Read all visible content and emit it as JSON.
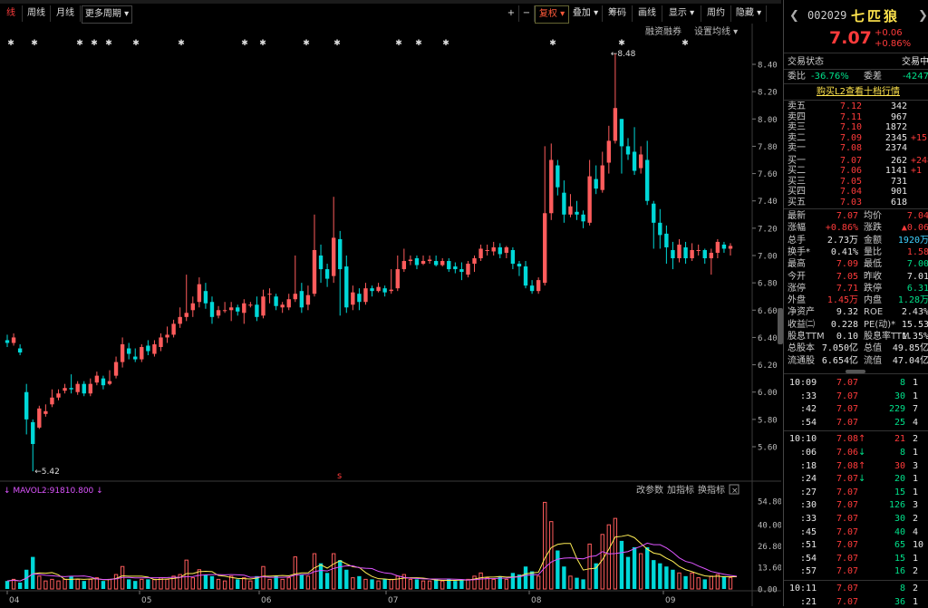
{
  "toolbar": {
    "buttons": [
      "线",
      "周线",
      "月线",
      "更多周期 ▾"
    ],
    "right_buttons": [
      "+",
      "−",
      "复权 ▾",
      "叠加 ▾",
      "筹码",
      "画线",
      "显示 ▾",
      "周约",
      "隐藏 ▾"
    ],
    "active": "线"
  },
  "chart": {
    "top_links": [
      "融资融券",
      "设置均线 ▾"
    ],
    "high_label": "8.48",
    "low_label": "5.42",
    "y_ticks": [
      "8.40",
      "8.20",
      "8.00",
      "7.80",
      "7.60",
      "7.40",
      "7.20",
      "7.00",
      "6.80",
      "6.60",
      "6.40",
      "6.20",
      "6.00",
      "5.80",
      "5.60"
    ],
    "s_marker": "s",
    "vol_indicator": "MAVOL2:91810.800",
    "vol_links": [
      "改参数",
      "加指标",
      "换指标"
    ],
    "vol_ticks": [
      "54.80",
      "40.00",
      "26.80",
      "13.60",
      "0.00"
    ],
    "months": [
      "04",
      "05",
      "06",
      "07",
      "08",
      "09"
    ]
  },
  "quote": {
    "code": "002029",
    "name": "七匹狼",
    "price": "7.07",
    "change": "+0.06",
    "change_pct": "+0.86%",
    "status_label": "交易状态",
    "status_value": "交易中",
    "wei_bi_label": "委比",
    "wei_bi": "-36.76%",
    "wei_cha_label": "委差",
    "wei_cha": "-4247",
    "buy_l2": "购买L2查看十档行情"
  },
  "asks": [
    {
      "label": "卖五",
      "price": "7.12",
      "vol": "342",
      "chg": ""
    },
    {
      "label": "卖四",
      "price": "7.11",
      "vol": "967",
      "chg": ""
    },
    {
      "label": "卖三",
      "price": "7.10",
      "vol": "1872",
      "chg": ""
    },
    {
      "label": "卖二",
      "price": "7.09",
      "vol": "2345",
      "chg": "+15"
    },
    {
      "label": "卖一",
      "price": "7.08",
      "vol": "2374",
      "chg": ""
    }
  ],
  "bids": [
    {
      "label": "买一",
      "price": "7.07",
      "vol": "262",
      "chg": "+248"
    },
    {
      "label": "买二",
      "price": "7.06",
      "vol": "1141",
      "chg": "+1"
    },
    {
      "label": "买三",
      "price": "7.05",
      "vol": "731",
      "chg": ""
    },
    {
      "label": "买四",
      "price": "7.04",
      "vol": "901",
      "chg": ""
    },
    {
      "label": "买五",
      "price": "7.03",
      "vol": "618",
      "chg": ""
    }
  ],
  "stats": [
    {
      "l1": "最新",
      "v1": "7.07",
      "c1": "red",
      "l2": "均价",
      "v2": "7.04",
      "c2": "red"
    },
    {
      "l1": "涨幅",
      "v1": "+0.86%",
      "c1": "red",
      "l2": "涨跌",
      "v2": "▲0.06",
      "c2": "red"
    },
    {
      "l1": "总手",
      "v1": "2.73万",
      "c1": "white",
      "l2": "金额",
      "v2": "1920万",
      "c2": "cyan"
    },
    {
      "l1": "换手*",
      "v1": "0.41%",
      "c1": "white",
      "l2": "量比",
      "v2": "1.58",
      "c2": "red"
    },
    {
      "l1": "最高",
      "v1": "7.09",
      "c1": "red",
      "l2": "最低",
      "v2": "7.00",
      "c2": "green"
    },
    {
      "l1": "今开",
      "v1": "7.05",
      "c1": "red",
      "l2": "昨收",
      "v2": "7.01",
      "c2": "white"
    },
    {
      "l1": "涨停",
      "v1": "7.71",
      "c1": "red",
      "l2": "跌停",
      "v2": "6.31",
      "c2": "green"
    },
    {
      "l1": "外盘",
      "v1": "1.45万",
      "c1": "red",
      "l2": "内盘",
      "v2": "1.28万",
      "c2": "green"
    },
    {
      "l1": "净资产",
      "v1": "9.32",
      "c1": "white",
      "l2": "ROE",
      "v2": "2.43%",
      "c2": "white"
    },
    {
      "l1": "收益㈡",
      "v1": "0.228",
      "c1": "white",
      "l2": "PE(动)*",
      "v2": "15.53",
      "c2": "white"
    },
    {
      "l1": "股息TTM",
      "v1": "0.10",
      "c1": "white",
      "l2": "股息率TTM",
      "v2": "1.35%",
      "c2": "white"
    },
    {
      "l1": "总股本",
      "v1": "7.050亿",
      "c1": "white",
      "l2": "总值",
      "v2": "49.85亿",
      "c2": "white"
    },
    {
      "l1": "流通股",
      "v1": "6.654亿",
      "c1": "white",
      "l2": "流值",
      "v2": "47.04亿",
      "c2": "white"
    }
  ],
  "ticks": [
    {
      "time": "10:09",
      "price": "7.07",
      "arrow": "",
      "vol": "8",
      "n": "1",
      "vc": "green"
    },
    {
      "time": ":33",
      "price": "7.07",
      "arrow": "",
      "vol": "30",
      "n": "1",
      "vc": "green"
    },
    {
      "time": ":42",
      "price": "7.07",
      "arrow": "",
      "vol": "229",
      "n": "7",
      "vc": "green"
    },
    {
      "time": ":54",
      "price": "7.07",
      "arrow": "",
      "vol": "25",
      "n": "4",
      "vc": "green"
    },
    {
      "time": "10:10",
      "price": "7.08",
      "arrow": "↑",
      "vol": "21",
      "n": "2",
      "vc": "red"
    },
    {
      "time": ":06",
      "price": "7.06",
      "arrow": "↓",
      "vol": "8",
      "n": "1",
      "vc": "green"
    },
    {
      "time": ":18",
      "price": "7.08",
      "arrow": "↑",
      "vol": "30",
      "n": "3",
      "vc": "red"
    },
    {
      "time": ":24",
      "price": "7.07",
      "arrow": "↓",
      "vol": "20",
      "n": "1",
      "vc": "green"
    },
    {
      "time": ":27",
      "price": "7.07",
      "arrow": "",
      "vol": "15",
      "n": "1",
      "vc": "green"
    },
    {
      "time": ":30",
      "price": "7.07",
      "arrow": "",
      "vol": "126",
      "n": "3",
      "vc": "green"
    },
    {
      "time": ":33",
      "price": "7.07",
      "arrow": "",
      "vol": "30",
      "n": "2",
      "vc": "green"
    },
    {
      "time": ":45",
      "price": "7.07",
      "arrow": "",
      "vol": "40",
      "n": "4",
      "vc": "green"
    },
    {
      "time": ":51",
      "price": "7.07",
      "arrow": "",
      "vol": "65",
      "n": "10",
      "vc": "green"
    },
    {
      "time": ":54",
      "price": "7.07",
      "arrow": "",
      "vol": "15",
      "n": "1",
      "vc": "green"
    },
    {
      "time": ":57",
      "price": "7.07",
      "arrow": "",
      "vol": "16",
      "n": "2",
      "vc": "green"
    },
    {
      "time": "10:11",
      "price": "7.07",
      "arrow": "",
      "vol": "8",
      "n": "2",
      "vc": "green"
    },
    {
      "time": ":21",
      "price": "7.07",
      "arrow": "",
      "vol": "36",
      "n": "1",
      "vc": "green"
    }
  ],
  "candles": [
    [
      6.38,
      6.36,
      6.42,
      6.33
    ],
    [
      6.36,
      6.4,
      6.43,
      6.34
    ],
    [
      6.32,
      6.29,
      6.35,
      6.27
    ],
    [
      6.0,
      5.8,
      6.06,
      5.69
    ],
    [
      5.78,
      5.62,
      5.8,
      5.42
    ],
    [
      5.74,
      5.88,
      5.9,
      5.73
    ],
    [
      5.84,
      5.86,
      5.91,
      5.82
    ],
    [
      5.91,
      5.96,
      6.02,
      5.89
    ],
    [
      5.96,
      5.99,
      6.02,
      5.94
    ],
    [
      6.01,
      6.03,
      6.06,
      5.99
    ],
    [
      6.03,
      6.02,
      6.13,
      5.99
    ],
    [
      6.0,
      6.06,
      6.08,
      5.98
    ],
    [
      6.06,
      5.99,
      6.08,
      5.97
    ],
    [
      5.99,
      6.06,
      6.1,
      5.97
    ],
    [
      6.07,
      6.12,
      6.15,
      6.05
    ],
    [
      6.1,
      6.05,
      6.12,
      6.02
    ],
    [
      6.06,
      6.08,
      6.16,
      6.05
    ],
    [
      6.12,
      6.22,
      6.26,
      6.1
    ],
    [
      6.22,
      6.35,
      6.4,
      6.18
    ],
    [
      6.32,
      6.28,
      6.36,
      6.24
    ],
    [
      6.26,
      6.24,
      6.32,
      6.22
    ],
    [
      6.24,
      6.33,
      6.35,
      6.22
    ],
    [
      6.34,
      6.3,
      6.38,
      6.27
    ],
    [
      6.28,
      6.35,
      6.38,
      6.26
    ],
    [
      6.33,
      6.4,
      6.43,
      6.3
    ],
    [
      6.4,
      6.42,
      6.48,
      6.36
    ],
    [
      6.42,
      6.5,
      6.53,
      6.4
    ],
    [
      6.5,
      6.55,
      6.62,
      6.47
    ],
    [
      6.55,
      6.58,
      6.86,
      6.52
    ],
    [
      6.6,
      6.65,
      6.7,
      6.55
    ],
    [
      6.66,
      6.79,
      6.84,
      6.62
    ],
    [
      6.74,
      6.65,
      6.8,
      6.61
    ],
    [
      6.66,
      6.55,
      6.7,
      6.5
    ],
    [
      6.56,
      6.6,
      6.63,
      6.54
    ],
    [
      6.6,
      6.6,
      6.66,
      6.58
    ],
    [
      6.6,
      6.62,
      6.66,
      6.52
    ],
    [
      6.62,
      6.59,
      6.64,
      6.56
    ],
    [
      6.58,
      6.65,
      6.68,
      6.5
    ],
    [
      6.64,
      6.64,
      6.66,
      6.62
    ],
    [
      6.64,
      6.55,
      6.7,
      6.52
    ],
    [
      6.56,
      6.7,
      6.75,
      6.54
    ],
    [
      6.72,
      6.72,
      6.76,
      6.65
    ],
    [
      6.7,
      6.63,
      6.72,
      6.6
    ],
    [
      6.62,
      6.64,
      6.66,
      6.58
    ],
    [
      6.62,
      6.68,
      6.72,
      6.6
    ],
    [
      6.68,
      6.72,
      7.0,
      6.66
    ],
    [
      6.74,
      6.62,
      6.8,
      6.58
    ],
    [
      6.64,
      6.71,
      6.78,
      6.6
    ],
    [
      6.72,
      7.04,
      7.3,
      6.7
    ],
    [
      7.0,
      6.9,
      7.08,
      6.8
    ],
    [
      6.9,
      6.83,
      6.94,
      6.77
    ],
    [
      6.85,
      7.13,
      7.43,
      6.8
    ],
    [
      7.12,
      6.9,
      7.18,
      6.56
    ],
    [
      6.92,
      6.62,
      7.0,
      6.58
    ],
    [
      6.64,
      6.73,
      6.78,
      6.6
    ],
    [
      6.72,
      6.66,
      6.76,
      6.6
    ],
    [
      6.66,
      6.76,
      6.8,
      6.64
    ],
    [
      6.76,
      6.74,
      6.78,
      6.7
    ],
    [
      6.74,
      6.77,
      6.8,
      6.73
    ],
    [
      6.76,
      6.73,
      6.78,
      6.7
    ],
    [
      6.74,
      6.75,
      6.9,
      6.72
    ],
    [
      6.76,
      6.9,
      7.0,
      6.74
    ],
    [
      6.9,
      6.96,
      7.05,
      6.88
    ],
    [
      6.96,
      6.97,
      7.0,
      6.93
    ],
    [
      6.98,
      6.93,
      7.0,
      6.9
    ],
    [
      6.94,
      6.96,
      7.0,
      6.93
    ],
    [
      6.96,
      6.97,
      7.0,
      6.94
    ],
    [
      6.96,
      6.93,
      7.0,
      6.92
    ],
    [
      6.93,
      6.96,
      6.98,
      6.92
    ],
    [
      6.96,
      6.9,
      6.98,
      6.88
    ],
    [
      6.92,
      6.9,
      6.95,
      6.87
    ],
    [
      6.9,
      6.88,
      6.95,
      6.82
    ],
    [
      6.86,
      6.94,
      6.96,
      6.84
    ],
    [
      6.94,
      6.98,
      7.0,
      6.88
    ],
    [
      6.98,
      7.05,
      7.08,
      6.96
    ],
    [
      7.04,
      7.04,
      7.08,
      7.0
    ],
    [
      7.03,
      7.06,
      7.1,
      7.0
    ],
    [
      7.06,
      7.01,
      7.09,
      6.98
    ],
    [
      7.02,
      7.06,
      7.07,
      6.98
    ],
    [
      7.04,
      6.94,
      7.06,
      6.9
    ],
    [
      6.94,
      6.92,
      6.96,
      6.85
    ],
    [
      6.92,
      6.78,
      6.96,
      6.76
    ],
    [
      6.78,
      6.74,
      6.82,
      6.72
    ],
    [
      6.74,
      6.82,
      6.84,
      6.72
    ],
    [
      6.8,
      7.31,
      7.8,
      6.78
    ],
    [
      7.31,
      7.7,
      7.82,
      7.26
    ],
    [
      7.66,
      7.5,
      7.7,
      7.44
    ],
    [
      7.46,
      7.3,
      7.55,
      7.24
    ],
    [
      7.3,
      7.36,
      7.45,
      7.28
    ],
    [
      7.32,
      7.3,
      7.4,
      7.26
    ],
    [
      7.3,
      7.25,
      7.33,
      7.2
    ],
    [
      7.24,
      7.58,
      7.7,
      7.22
    ],
    [
      7.56,
      7.49,
      7.66,
      7.45
    ],
    [
      7.48,
      7.66,
      7.76,
      7.46
    ],
    [
      7.68,
      7.84,
      7.95,
      7.6
    ],
    [
      7.84,
      8.08,
      8.48,
      7.82
    ],
    [
      8.0,
      7.8,
      8.0,
      7.6
    ],
    [
      7.8,
      7.74,
      7.86,
      7.7
    ],
    [
      7.76,
      7.62,
      7.94,
      7.59
    ],
    [
      7.64,
      7.74,
      7.8,
      7.6
    ],
    [
      7.7,
      7.4,
      7.84,
      7.37
    ],
    [
      7.38,
      7.24,
      7.4,
      7.05
    ],
    [
      7.24,
      7.15,
      7.34,
      7.05
    ],
    [
      7.16,
      7.06,
      7.22,
      6.94
    ],
    [
      7.04,
      6.98,
      7.1,
      6.9
    ],
    [
      6.98,
      7.08,
      7.12,
      6.95
    ],
    [
      7.06,
      6.98,
      7.1,
      6.94
    ],
    [
      6.98,
      7.04,
      7.09,
      6.96
    ],
    [
      7.04,
      7.04,
      7.08,
      7.0
    ],
    [
      7.04,
      6.98,
      7.05,
      6.94
    ],
    [
      6.98,
      7.02,
      7.05,
      6.86
    ],
    [
      7.02,
      7.1,
      7.12,
      6.98
    ],
    [
      7.08,
      7.05,
      7.1,
      7.02
    ],
    [
      7.05,
      7.07,
      7.09,
      7.0
    ]
  ],
  "volumes": [
    5,
    6,
    4,
    12,
    20,
    8,
    5,
    6,
    5,
    6,
    8,
    6,
    5,
    6,
    7,
    5,
    6,
    9,
    14,
    6,
    5,
    6,
    6,
    6,
    7,
    6,
    8,
    9,
    18,
    7,
    12,
    9,
    8,
    6,
    5,
    8,
    6,
    7,
    5,
    8,
    14,
    6,
    8,
    6,
    7,
    20,
    9,
    8,
    22,
    16,
    10,
    22,
    18,
    12,
    7,
    8,
    6,
    6,
    5,
    6,
    6,
    8,
    9,
    6,
    6,
    5,
    5,
    6,
    5,
    6,
    5,
    6,
    6,
    8,
    10,
    7,
    6,
    8,
    6,
    10,
    9,
    14,
    11,
    8,
    54,
    42,
    24,
    14,
    8,
    7,
    6,
    28,
    16,
    34,
    40,
    44,
    30,
    20,
    26,
    22,
    26,
    18,
    16,
    14,
    12,
    10,
    8,
    10,
    7,
    6,
    8,
    9,
    8,
    7,
    6
  ]
}
